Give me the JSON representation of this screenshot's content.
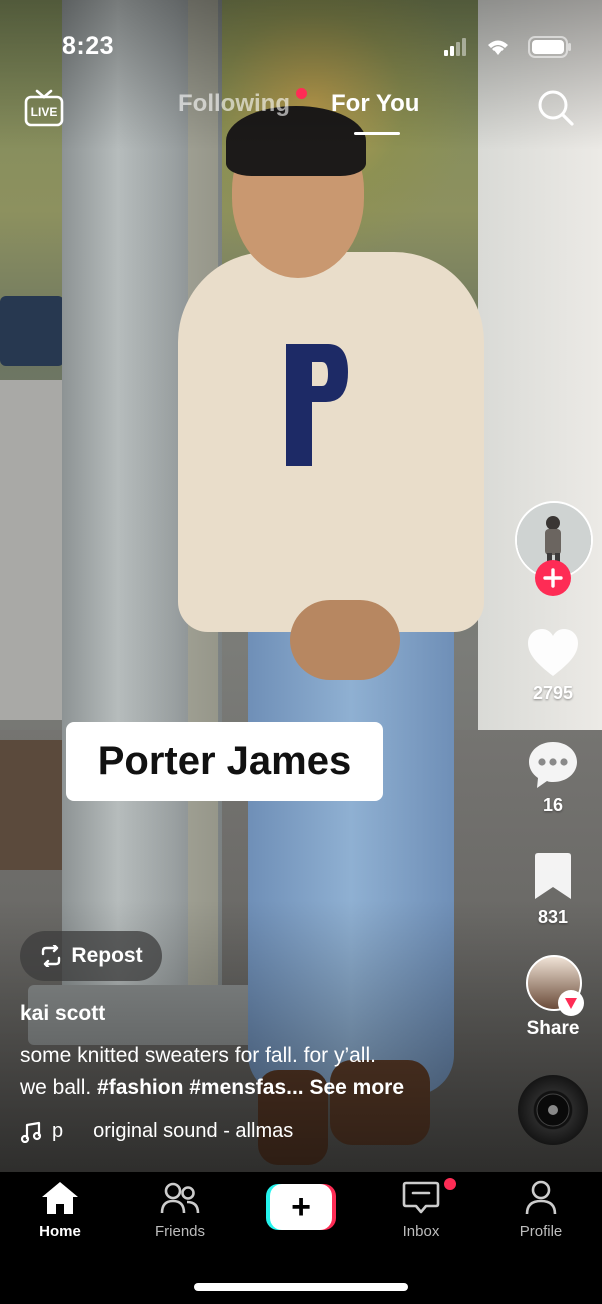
{
  "status_bar": {
    "time": "8:23"
  },
  "top_nav": {
    "live_label": "LIVE",
    "tabs": [
      {
        "label": "Following",
        "active": false,
        "has_notification_dot": true
      },
      {
        "label": "For You",
        "active": true
      }
    ]
  },
  "video": {
    "overlay_text": "Porter James",
    "repost_label": "Repost",
    "username": "kai scott",
    "description_line1": "some knitted sweaters for fall. for y’all.",
    "description_line2_prefix": "we ball. ",
    "hashtags_text": "#fashion #mensfas...",
    "see_more_label": "See more",
    "sound_prefix": "p",
    "sound_title": "original sound - allmas"
  },
  "actions": {
    "likes": "2795",
    "comments": "16",
    "bookmarks": "831",
    "share_label": "Share"
  },
  "bottom_nav": {
    "items": [
      {
        "label": "Home",
        "active": true
      },
      {
        "label": "Friends",
        "active": false
      },
      {
        "label": "Inbox",
        "active": false,
        "has_notification_dot": true
      },
      {
        "label": "Profile",
        "active": false
      }
    ],
    "create_label": "+"
  },
  "colors": {
    "accent": "#fe2c55",
    "cyan": "#25f4ee",
    "tabbar": "#000000"
  }
}
